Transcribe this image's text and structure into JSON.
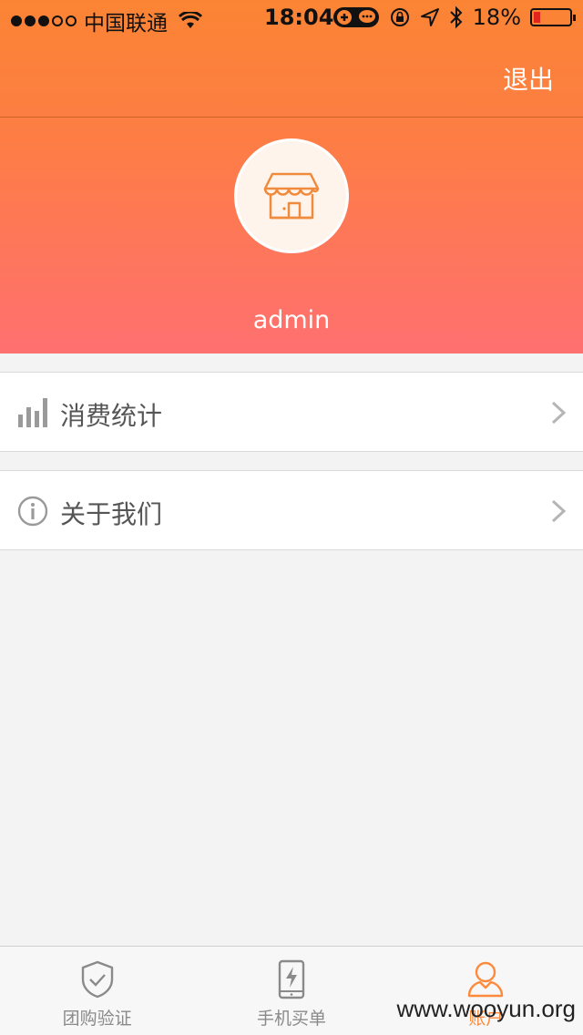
{
  "status_bar": {
    "carrier": "中国联通",
    "time": "18:04",
    "battery": "18%",
    "battery_level": 0.18
  },
  "nav": {
    "logout_label": "退出"
  },
  "profile": {
    "avatar_icon": "store-icon",
    "username": "admin"
  },
  "menu": {
    "items": [
      {
        "label": "消费统计",
        "icon": "bar-chart-icon"
      },
      {
        "label": "关于我们",
        "icon": "info-icon"
      }
    ]
  },
  "tab_bar": {
    "items": [
      {
        "label": "团购验证",
        "icon": "shield-check-icon",
        "active": false
      },
      {
        "label": "手机买单",
        "icon": "phone-bolt-icon",
        "active": false
      },
      {
        "label": "账户",
        "icon": "user-icon",
        "active": true
      }
    ]
  },
  "watermark": "www.wooyun.org",
  "colors": {
    "header_top": "#fb8434",
    "header_bottom": "#ff7070",
    "accent": "#fd8a3c"
  }
}
